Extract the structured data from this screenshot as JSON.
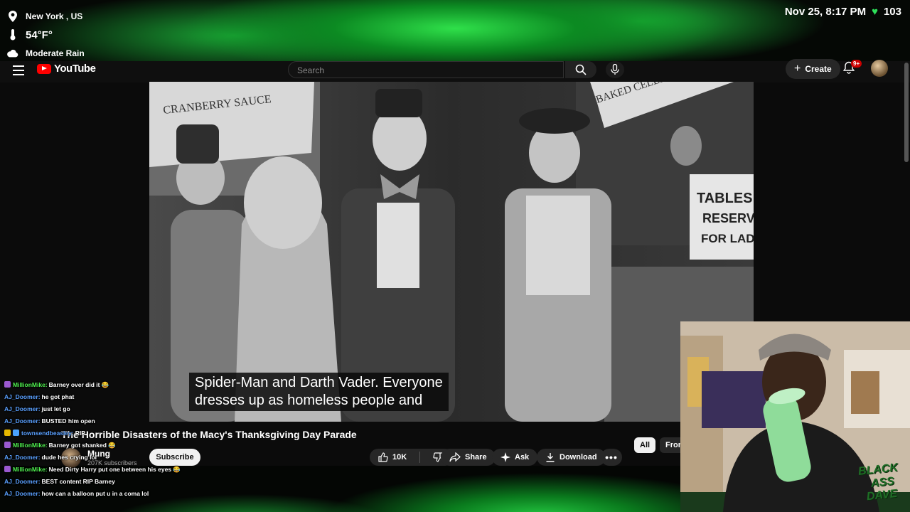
{
  "overlay": {
    "location": "New York , US",
    "temperature": "54°F°",
    "condition": "Moderate Rain",
    "datetime": "Nov 25, 8:17 PM",
    "viewer_count": "103"
  },
  "header": {
    "logo_text": "YouTube",
    "search_placeholder": "Search",
    "create_label": "Create",
    "notification_badge": "9+"
  },
  "video": {
    "sign_left_text": "CRANBERRY SAUCE",
    "sign_right_text": "BAKED CELERY",
    "sign_tables_lines": [
      "TABLES",
      "RESERVE",
      "FOR LADIE"
    ],
    "caption_lines": [
      "Spider-Man and Darth Vader. Everyone",
      "dresses up as homeless people and"
    ]
  },
  "info": {
    "title": "The Horrible Disasters of the Macy's Thanksgiving Day Parade",
    "channel": "Mung",
    "subscribers": "207K subscribers",
    "subscribe_label": "Subscribe",
    "likes": "10K",
    "share_label": "Share",
    "ask_label": "Ask",
    "download_label": "Download",
    "chip_all": "All",
    "chip_from": "From"
  },
  "chat": [
    {
      "user": "MillionMike:",
      "message": "Barney over did it 😂",
      "color": "#4ff04f"
    },
    {
      "user": "AJ_Doomer:",
      "message": "he got phat",
      "color": "#5aa0ff"
    },
    {
      "user": "AJ_Doomer:",
      "message": "just let go",
      "color": "#5aa0ff"
    },
    {
      "user": "AJ_Doomer:",
      "message": "BUSTED him open",
      "color": "#5aa0ff"
    },
    {
      "user": "townsendbeasley:",
      "message": "RIP",
      "color": "#5aa0ff"
    },
    {
      "user": "MillionMike:",
      "message": "Barney got shanked 😂",
      "color": "#4ff04f"
    },
    {
      "user": "AJ_Doomer:",
      "message": "dude hes crying lol",
      "color": "#5aa0ff"
    },
    {
      "user": "MillionMike:",
      "message": "Need Dirty Harry put one between his eyes 😂",
      "color": "#4ff04f"
    },
    {
      "user": "AJ_Doomer:",
      "message": "BEST content RIP Barney",
      "color": "#5aa0ff"
    },
    {
      "user": "AJ_Doomer:",
      "message": "how can a balloon put u in a coma lol",
      "color": "#5aa0ff"
    }
  ],
  "webcam": {
    "overlay_text_1": "BLACK",
    "overlay_text_2": "ASS",
    "overlay_text_3": "DAVE"
  }
}
